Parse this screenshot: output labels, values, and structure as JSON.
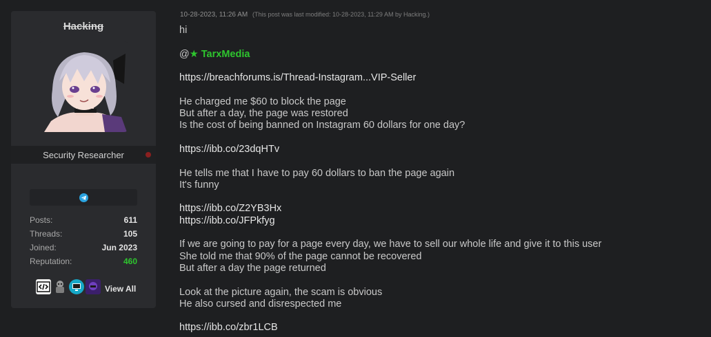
{
  "user": {
    "username": "Hacking",
    "title": "Security Researcher",
    "stats": [
      {
        "label": "Posts:",
        "value": "611"
      },
      {
        "label": "Threads:",
        "value": "105"
      },
      {
        "label": "Joined:",
        "value": "Jun 2023"
      },
      {
        "label": "Reputation:",
        "value": "460"
      }
    ],
    "awards_link": "View All",
    "colors": {
      "reputation": "#2ec52e",
      "online_dot": "#8a1f1f",
      "telegram": "#2aa3e0"
    }
  },
  "post": {
    "date": "10-28-2023, 11:26 AM",
    "edit_note": "(This post was last modified: 10-28-2023, 11:29 AM by Hacking.)",
    "line_greeting": "hi",
    "mention_prefix": "@",
    "mention_star": "★",
    "mention_name": "TarxMedia",
    "link1": "https://breachforums.is/Thread-Instagram...VIP-Seller",
    "p1_l1": "He charged me $60 to block the page",
    "p1_l2": "But after a day, the page was restored",
    "p1_l3": "Is the cost of being banned on Instagram 60 dollars for one day?",
    "link2": "https://ibb.co/23dqHTv",
    "p2_l1": "He tells me that I have to pay 60 dollars to ban the page again",
    "p2_l2": "It's funny",
    "link3": "https://ibb.co/Z2YB3Hx",
    "link4": "https://ibb.co/JFPkfyg",
    "p3_l1": "If we are going to pay for a page every day, we have to sell our whole life and give it to this user",
    "p3_l2": "She told me that 90% of the page cannot be recovered",
    "p3_l3": "But after a day the page returned",
    "p4_l1": "Look at the picture again, the scam is obvious",
    "p4_l2": "He also cursed and disrespected me",
    "link5": "https://ibb.co/zbr1LCB"
  }
}
